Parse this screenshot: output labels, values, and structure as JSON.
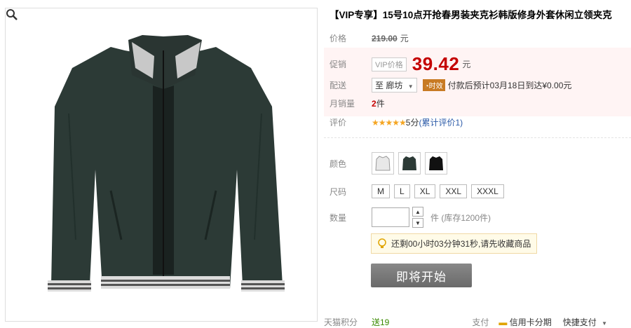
{
  "product": {
    "title": "【VIP专享】15号10点开抢春男装夹克衫韩版修身外套休闲立领夹克"
  },
  "price": {
    "label": "价格",
    "original": "219.00",
    "unit": "元"
  },
  "promo": {
    "label": "促销",
    "tag": "VIP价格",
    "value": "39.42",
    "unit": "元"
  },
  "shipping": {
    "label": "配送",
    "destination": "至 廊坊",
    "time_tag": "时效",
    "estimate": "付款后预计03月18日到达¥0.00元"
  },
  "monthly_sales": {
    "label": "月销量",
    "count": "2",
    "unit": "件"
  },
  "rating": {
    "label": "评价",
    "stars": "★★★★★",
    "score": "5分",
    "link": "(累计评价1)"
  },
  "color": {
    "label": "颜色",
    "options": [
      "white-jacket",
      "dark-jacket",
      "black-jacket"
    ]
  },
  "size": {
    "label": "尺码",
    "options": [
      "M",
      "L",
      "XL",
      "XXL",
      "XXXL"
    ]
  },
  "quantity": {
    "label": "数量",
    "value": "",
    "stock_text": "件 (库存1200件)"
  },
  "countdown": {
    "text": "还剩00小时03分钟31秒,请先收藏商品"
  },
  "buy_button": {
    "label": "即将开始"
  },
  "bottom": {
    "points_label": "天猫积分",
    "points_value": "送19",
    "pay_label": "支付",
    "credit": "信用卡分期",
    "fast_pay": "快捷支付"
  },
  "colors": {
    "price_red": "#c40000",
    "star": "#f5a623",
    "link": "#2b5aa8",
    "jacket": "#2c3a36"
  }
}
